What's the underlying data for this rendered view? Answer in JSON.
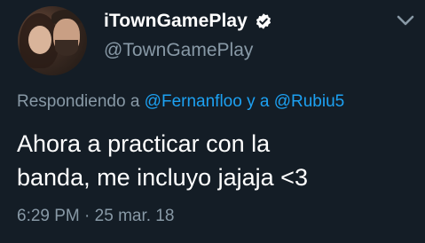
{
  "author": {
    "display_name": "iTownGamePlay",
    "handle": "@TownGamePlay",
    "verified": true
  },
  "reply": {
    "prefix": "Respondiendo a",
    "mention_1": "@Fernanfloo",
    "connector": "y a",
    "mention_2": "@Rubiu5"
  },
  "tweet": {
    "line_1": "Ahora a practicar con la",
    "line_2": "banda, me incluyo jajaja <3"
  },
  "meta": {
    "time": "6:29 PM",
    "separator": "·",
    "date": "25 mar. 18"
  },
  "icons": {
    "verified": "verified-badge-icon",
    "menu": "chevron-down-icon"
  },
  "colors": {
    "background": "#141d26",
    "mention": "#1da1f2",
    "secondary_text": "#8899a6",
    "primary_text": "#ffffff"
  }
}
